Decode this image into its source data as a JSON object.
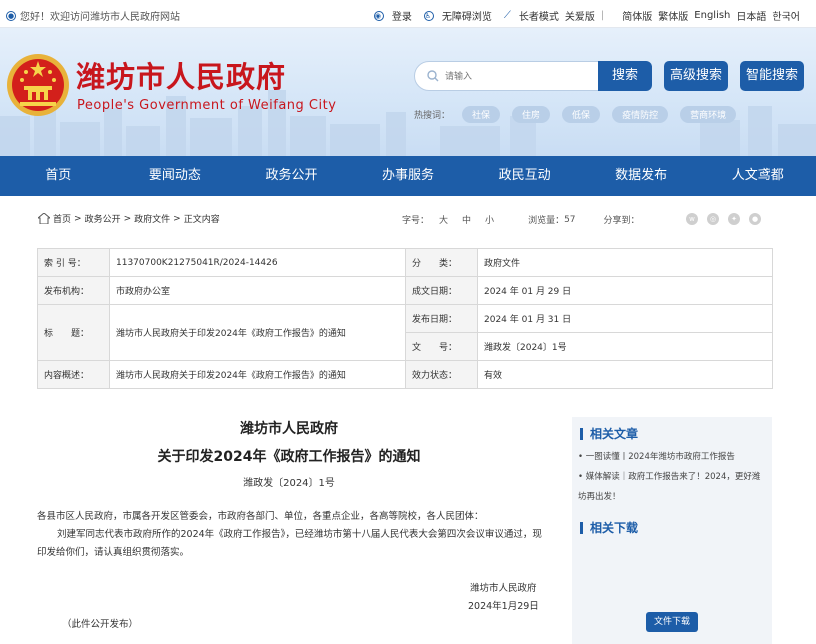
{
  "topbar": {
    "welcome": "您好！欢迎访问潍坊市人民政府网站",
    "login": "登录",
    "accessible": "无障碍浏览",
    "elder": "长者模式",
    "care": "关爱版",
    "lang_simplified": "简体版",
    "lang_traditional": "繁体版",
    "lang_english": "English",
    "lang_japanese": "日本語",
    "lang_korean": "한국어"
  },
  "header": {
    "title_cn": "潍坊市人民政府",
    "title_en": "People's Government of Weifang City",
    "search_placeholder": "请输入",
    "search_button": "搜索",
    "advanced_search": "高级搜索",
    "smart_search": "智能搜索",
    "hotwords_label": "热搜词：",
    "hotwords": [
      "社保",
      "住房",
      "低保",
      "疫情防控",
      "营商环境"
    ]
  },
  "nav": [
    "首页",
    "要闻动态",
    "政务公开",
    "办事服务",
    "政民互动",
    "数据发布",
    "人文鸢都"
  ],
  "breadcrumb": [
    "首页",
    "政务公开",
    "政府文件",
    "正文内容"
  ],
  "tools": {
    "font_label": "字号：",
    "large": "大",
    "medium": "中",
    "small": "小",
    "views_label": "浏览量：",
    "views": "57",
    "share_label": "分享到："
  },
  "meta": {
    "index_label": "索 引 号：",
    "index_value": "11370700K21275041R/2024-14426",
    "category_label": "分　　类：",
    "category_value": "政府文件",
    "publisher_label": "发布机构：",
    "publisher_value": "市政府办公室",
    "created_label": "成文日期：",
    "created_value": "2024 年 01 月 29 日",
    "title_label": "标　　题：",
    "title_value": "潍坊市人民政府关于印发2024年《政府工作报告》的通知",
    "published_label": "发布日期：",
    "published_value": "2024 年 01 月 31 日",
    "docno_label": "文　　号：",
    "docno_value": "潍政发〔2024〕1号",
    "summary_label": "内容概述：",
    "summary_value": "潍坊市人民政府关于印发2024年《政府工作报告》的通知",
    "status_label": "效力状态：",
    "status_value": "有效"
  },
  "document": {
    "title_line1": "潍坊市人民政府",
    "title_line2": "关于印发2024年《政府工作报告》的通知",
    "doc_number": "潍政发〔2024〕1号",
    "addressee": "各县市区人民政府，市属各开发区管委会，市政府各部门、单位，各重点企业，各高等院校，各人民团体：",
    "paragraph": "刘建军同志代表市政府所作的2024年《政府工作报告》，已经潍坊市第十八届人民代表大会第四次会议审议通过，现印发给你们，请认真组织贯彻落实。",
    "signer": "潍坊市人民政府",
    "date": "2024年1月29日",
    "note": "（此件公开发布）"
  },
  "sidebar": {
    "related_articles_title": "相关文章",
    "related_articles": [
      "一图读懂丨2024年潍坊市政府工作报告",
      "媒体解读｜政府工作报告来了！2024，更好潍坊再出发！"
    ],
    "related_downloads_title": "相关下载",
    "download_button": "文件下载"
  },
  "colors": {
    "brand_blue": "#1d5da8",
    "title_red": "#c8161d"
  }
}
